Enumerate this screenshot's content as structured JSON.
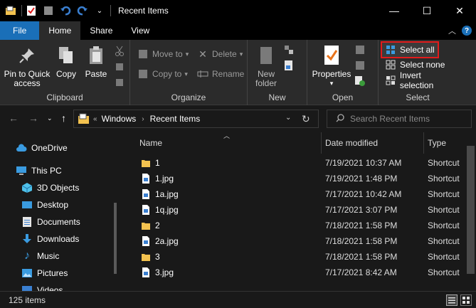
{
  "window": {
    "title": "Recent Items",
    "minimize_glyph": "—",
    "maximize_glyph": "☐",
    "close_glyph": "✕"
  },
  "ribbon_tabs": [
    "File",
    "Home",
    "Share",
    "View"
  ],
  "ribbon": {
    "clipboard": {
      "label": "Clipboard",
      "pin_label_1": "Pin to Quick",
      "pin_label_2": "access",
      "copy": "Copy",
      "paste": "Paste"
    },
    "organize": {
      "label": "Organize",
      "move_to": "Move to",
      "copy_to": "Copy to",
      "delete": "Delete",
      "rename": "Rename"
    },
    "new": {
      "label": "New",
      "new_folder_1": "New",
      "new_folder_2": "folder"
    },
    "open": {
      "label": "Open",
      "properties": "Properties"
    },
    "select": {
      "label": "Select",
      "select_all": "Select all",
      "select_none": "Select none",
      "invert_selection": "Invert selection"
    }
  },
  "address": {
    "root_chevron": "«",
    "crumbs": [
      "Windows",
      "Recent Items"
    ]
  },
  "search": {
    "placeholder": "Search Recent Items"
  },
  "nav_pane": {
    "items": [
      "OneDrive",
      "This PC",
      "3D Objects",
      "Desktop",
      "Documents",
      "Downloads",
      "Music",
      "Pictures",
      "Videos"
    ]
  },
  "columns": {
    "name": "Name",
    "date": "Date modified",
    "type": "Type"
  },
  "files": [
    {
      "name": "1",
      "date": "7/19/2021 10:37 AM",
      "type": "Shortcut",
      "kind": "folder"
    },
    {
      "name": "1.jpg",
      "date": "7/19/2021 1:48 PM",
      "type": "Shortcut",
      "kind": "file"
    },
    {
      "name": "1a.jpg",
      "date": "7/17/2021 10:42 AM",
      "type": "Shortcut",
      "kind": "file"
    },
    {
      "name": "1q.jpg",
      "date": "7/17/2021 3:07 PM",
      "type": "Shortcut",
      "kind": "file"
    },
    {
      "name": "2",
      "date": "7/18/2021 1:58 PM",
      "type": "Shortcut",
      "kind": "folder"
    },
    {
      "name": "2a.jpg",
      "date": "7/18/2021 1:58 PM",
      "type": "Shortcut",
      "kind": "file"
    },
    {
      "name": "3",
      "date": "7/18/2021 1:58 PM",
      "type": "Shortcut",
      "kind": "folder"
    },
    {
      "name": "3.jpg",
      "date": "7/17/2021 8:42 AM",
      "type": "Shortcut",
      "kind": "file"
    }
  ],
  "status": {
    "item_count": "125 items"
  },
  "colors": {
    "accent": "#1a6fb8",
    "highlight_border": "#e21b1b",
    "folder": "#f3c24f"
  }
}
